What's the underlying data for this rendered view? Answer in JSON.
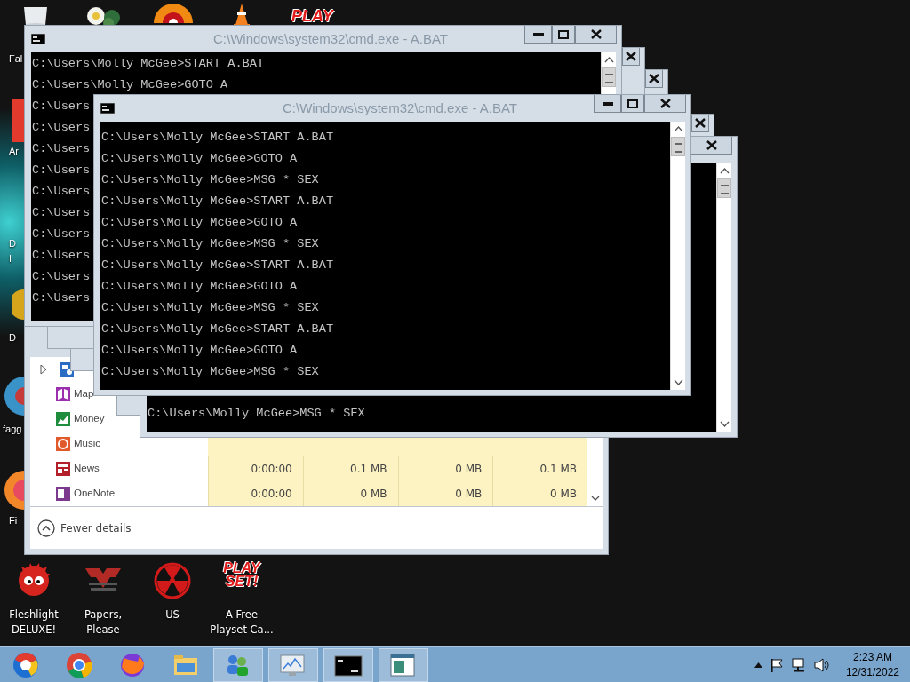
{
  "desktop_icons": [
    {
      "label": "Fal"
    },
    {
      "label": "Ar"
    },
    {
      "label": "D\nI"
    },
    {
      "label": "D"
    },
    {
      "label": "fagg"
    },
    {
      "label": "Fi"
    }
  ],
  "top_logo_text": "PLAY",
  "bottom_icons": [
    {
      "label": "Fleshlight DELUXE!"
    },
    {
      "label": "Papers, Please"
    },
    {
      "label": "US"
    },
    {
      "label": "A Free Playset Ca...",
      "logo_text": "PLAY SET!"
    }
  ],
  "task_manager": {
    "rows": [
      {
        "kind": "group",
        "expanded": false
      },
      {
        "kind": "app",
        "name": "Map"
      },
      {
        "kind": "app",
        "name": "Money"
      },
      {
        "kind": "app",
        "name": "Music"
      },
      {
        "kind": "app",
        "name": "News",
        "cells": [
          "0:00:00",
          "0.1 MB",
          "0 MB",
          "0.1 MB"
        ]
      },
      {
        "kind": "app",
        "name": "OneNote",
        "cells": [
          "0:00:00",
          "0 MB",
          "0 MB",
          "0 MB"
        ]
      }
    ],
    "fewer_details": "Fewer details"
  },
  "cmd_windows": [
    {
      "kind": "console",
      "title": "C:\\Windows\\system32\\cmd.exe - A.BAT",
      "lines": [
        "C:\\Users\\Molly McGee>START A.BAT",
        "C:\\Users\\Molly McGee>GOTO A",
        "C:\\Users",
        "C:\\Users",
        "C:\\Users",
        "C:\\Users",
        "C:\\Users",
        "C:\\Users",
        "C:\\Users",
        "C:\\Users",
        "C:\\Users",
        "C:\\Users"
      ]
    },
    {
      "kind": "stacked"
    },
    {
      "kind": "stacked"
    },
    {
      "kind": "console",
      "title": "C:\\Windows\\system32\\cmd.exe - A.BAT",
      "lines": [
        "C:\\Users\\Molly McGee>START A.BAT",
        "C:\\Users\\Molly McGee>GOTO A",
        "C:\\Users\\Molly McGee>MSG * SEX",
        "C:\\Users\\Molly McGee>START A.BAT",
        "C:\\Users\\Molly McGee>GOTO A",
        "C:\\Users\\Molly McGee>MSG * SEX",
        "C:\\Users\\Molly McGee>START A.BAT",
        "C:\\Users\\Molly McGee>GOTO A",
        "C:\\Users\\Molly McGee>MSG * SEX",
        "C:\\Users\\Molly McGee>START A.BAT",
        "C:\\Users\\Molly McGee>GOTO A",
        "C:\\Users\\Molly McGee>MSG * SEX"
      ]
    },
    {
      "kind": "stacked"
    },
    {
      "kind": "console",
      "lines": [
        "C:\\Users\\Molly McGee>MSG * SEX"
      ]
    }
  ],
  "taskbar": {
    "time": "2:23 AM",
    "date": "12/31/2022"
  }
}
